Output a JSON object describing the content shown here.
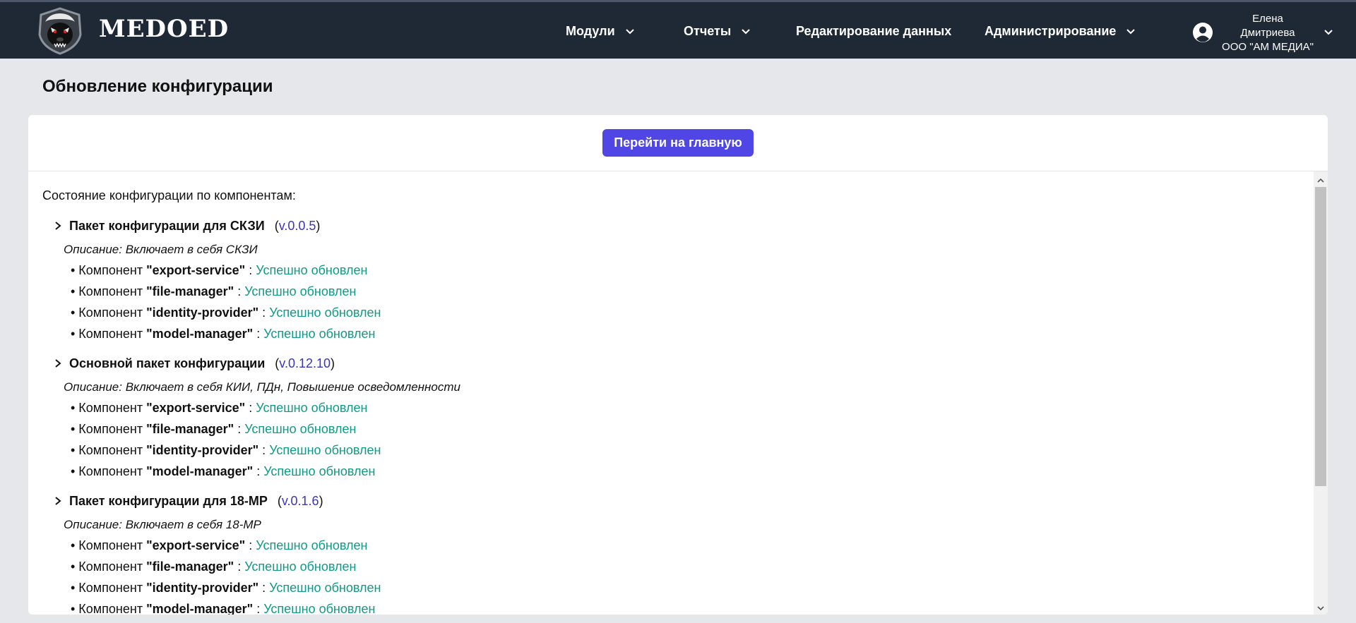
{
  "header": {
    "logo_text": "MEDOED",
    "nav": [
      {
        "label": "Модули",
        "has_dropdown": true
      },
      {
        "label": "Отчеты",
        "has_dropdown": true
      },
      {
        "label": "Редактирование данных",
        "has_dropdown": false
      },
      {
        "label": "Администрирование",
        "has_dropdown": true
      }
    ],
    "user": {
      "first_name": "Елена",
      "last_name": "Дмитриева",
      "org": "ООО \"АМ МЕДИА\""
    }
  },
  "page": {
    "title": "Обновление конфигурации",
    "home_button": "Перейти на главную",
    "state_heading": "Состояние конфигурации по компонентам:"
  },
  "labels": {
    "component_prefix": "• Компонент ",
    "separator": " : ",
    "description_prefix": "Описание: "
  },
  "packages": [
    {
      "name": "Пакет конфигурации для СКЗИ",
      "version": "v.0.0.5",
      "description": "Включает в себя СКЗИ",
      "components": [
        {
          "name": "\"export-service\"",
          "status": "Успешно обновлен"
        },
        {
          "name": "\"file-manager\"",
          "status": "Успешно обновлен"
        },
        {
          "name": "\"identity-provider\"",
          "status": "Успешно обновлен"
        },
        {
          "name": "\"model-manager\"",
          "status": "Успешно обновлен"
        }
      ]
    },
    {
      "name": "Основной пакет конфигурации",
      "version": "v.0.12.10",
      "description": "Включает в себя КИИ, ПДн, Повышение осведомленности",
      "components": [
        {
          "name": "\"export-service\"",
          "status": "Успешно обновлен"
        },
        {
          "name": "\"file-manager\"",
          "status": "Успешно обновлен"
        },
        {
          "name": "\"identity-provider\"",
          "status": "Успешно обновлен"
        },
        {
          "name": "\"model-manager\"",
          "status": "Успешно обновлен"
        }
      ]
    },
    {
      "name": "Пакет конфигурации для 18-МР",
      "version": "v.0.1.6",
      "description": "Включает в себя 18-МР",
      "components": [
        {
          "name": "\"export-service\"",
          "status": "Успешно обновлен"
        },
        {
          "name": "\"file-manager\"",
          "status": "Успешно обновлен"
        },
        {
          "name": "\"identity-provider\"",
          "status": "Успешно обновлен"
        },
        {
          "name": "\"model-manager\"",
          "status": "Успешно обновлен"
        }
      ]
    }
  ],
  "colors": {
    "header_bg": "#1f2936",
    "accent_button": "#4f46e5",
    "version_text": "#3b35b8",
    "success_text": "#0e9a86",
    "page_bg": "#e6e7eb"
  }
}
